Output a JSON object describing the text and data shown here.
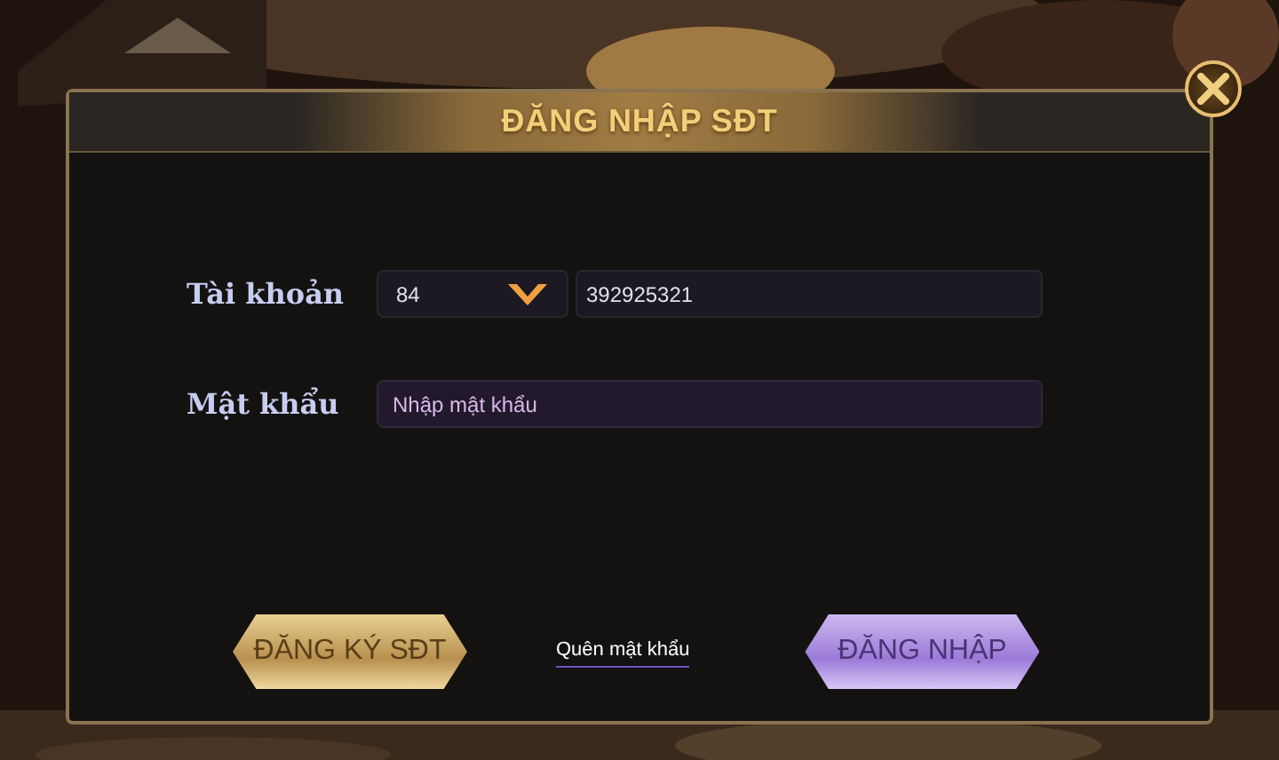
{
  "dialog": {
    "title": "ĐĂNG NHẬP SĐT"
  },
  "account": {
    "label": "Tài khoản",
    "country_code": "84",
    "phone": "392925321"
  },
  "password": {
    "label": "Mật khẩu",
    "placeholder": "Nhập mật khẩu"
  },
  "register_button": "ĐĂNG KÝ SĐT",
  "forgot_link": "Quên mật khẩu",
  "login_button": "ĐĂNG NHẬP"
}
